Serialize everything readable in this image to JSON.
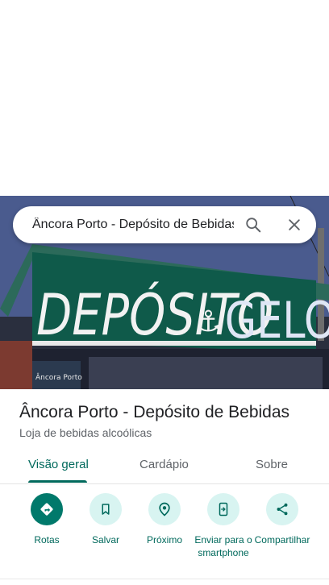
{
  "search": {
    "query": "Âncora Porto - Depósito de Bebidas",
    "search_icon": "search-icon",
    "close_icon": "close-icon"
  },
  "photo": {
    "banner_text_left": "DEPÓSITO",
    "banner_text_right": "GELO",
    "sign_text": "Âncora Porto",
    "banner_color": "#0f5a4a"
  },
  "place": {
    "title": "Âncora Porto - Depósito de Bebidas",
    "category": "Loja de bebidas alcoólicas"
  },
  "tabs": [
    {
      "label": "Visão geral",
      "active": true
    },
    {
      "label": "Cardápio",
      "active": false
    },
    {
      "label": "Sobre",
      "active": false
    }
  ],
  "actions": [
    {
      "label": "Rotas",
      "icon": "directions-icon"
    },
    {
      "label": "Salvar",
      "icon": "bookmark-icon"
    },
    {
      "label": "Próximo",
      "icon": "nearby-icon"
    },
    {
      "label": "Enviar para o smartphone",
      "icon": "send-to-phone-icon"
    },
    {
      "label": "Compartilhar",
      "icon": "share-icon"
    }
  ],
  "colors": {
    "accent": "#00695c",
    "primary_button": "#00796b",
    "action_bg": "#d8f4f1"
  }
}
